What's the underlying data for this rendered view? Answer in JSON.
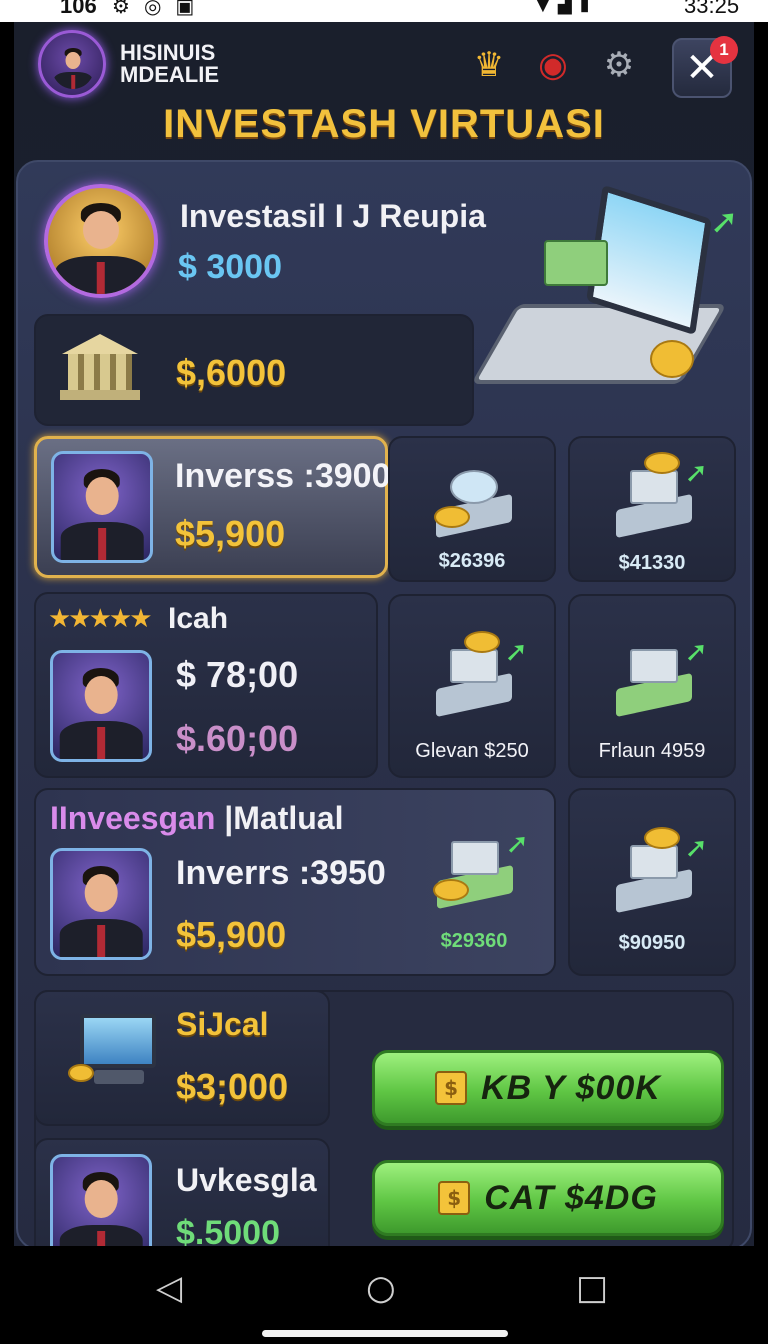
{
  "status_bar": {
    "time_left": "106",
    "icons_left": [
      "settings-notify-icon",
      "target-icon",
      "app-icon"
    ],
    "icons_right": [
      "wifi-icon",
      "signal-icon",
      "battery-icon"
    ],
    "time_right": "33:25"
  },
  "header": {
    "player_name_line1": "HISINUIS",
    "player_name_line2": "MDEALIE",
    "notification_count": "1",
    "close_glyph": "✕",
    "title": "INVESTASH VIRTUASI"
  },
  "profile_card": {
    "name": "Investasil I J Reupia",
    "balance": "$ 3000",
    "bank_value": "$,6000"
  },
  "row1": {
    "selected_card": {
      "label": "Inverss :3900",
      "value": "$5,900"
    },
    "tiles": [
      {
        "value": "$26396",
        "icon": "magnifier-coins-icon"
      },
      {
        "value": "$41330",
        "icon": "building-coins-icon"
      }
    ]
  },
  "row2": {
    "card": {
      "stars": "★★★★★",
      "label": "Icah",
      "value_primary": "$ 78;00",
      "value_secondary": "$.60;00"
    },
    "tiles": [
      {
        "value": "Glevan $250",
        "icon": "building-coins-icon"
      },
      {
        "value": "Frlaun 4959",
        "icon": "building-cash-icon"
      }
    ]
  },
  "row3": {
    "card": {
      "title_part1": "IInveesgan ",
      "title_part2": "|Matlual",
      "label": "Inverrs :3950",
      "value": "$5,900",
      "tile_value": "$29360"
    },
    "tile": {
      "value": "$90950",
      "icon": "building-coins-icon"
    }
  },
  "row4": {
    "card": {
      "label": "SiJcal",
      "value": "$3;000"
    },
    "button": {
      "label": "KB Y $00K",
      "icon": "coin-icon",
      "icon_glyph": "$"
    }
  },
  "row5": {
    "card": {
      "label": "Uvkesgla",
      "value": "$.5000"
    },
    "button": {
      "label": "CAT $4DG",
      "icon": "cash-stack-icon",
      "icon_glyph": "$"
    }
  },
  "colors": {
    "accent_gold": "#f3c33a",
    "accent_green": "#5fc644",
    "notify_red": "#e53340",
    "panel_bg": "#2a3049"
  }
}
